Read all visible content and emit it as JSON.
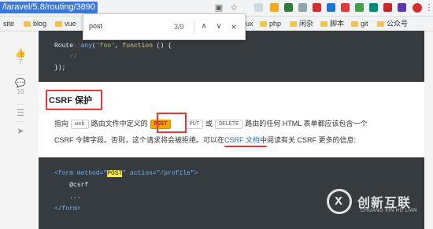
{
  "browser": {
    "url": "/laravel/5.8/routing/3890",
    "bookmarks": [
      {
        "label": "site"
      },
      {
        "label": "blog"
      },
      {
        "label": "vue"
      },
      {
        "label": "ux"
      },
      {
        "label": "php"
      },
      {
        "label": "闲杂"
      },
      {
        "label": "脚本"
      },
      {
        "label": "git"
      },
      {
        "label": "公众号"
      }
    ]
  },
  "find": {
    "query": "post",
    "count": "3/9",
    "prev": "∧",
    "next": "∨",
    "close": "×"
  },
  "sidebar": {
    "likes": "7",
    "comments": "10"
  },
  "code1": {
    "line1_a": "Route",
    "line1_b": "::",
    "line1_c": "any",
    "line1_d": "(",
    "line1_e": "'foo'",
    "line1_f": ", ",
    "line1_g": "function",
    "line1_h": " () {",
    "line2": "    //",
    "line3": "});"
  },
  "section": {
    "heading": "CSRF 保护",
    "p1_a": "指向",
    "p1_tag_web": "web",
    "p1_b": "路由文件中定义的",
    "p1_tag_post": "POST",
    "p1_tag_put": "PUT",
    "p1_c": "或",
    "p1_tag_delete": "DELETE",
    "p1_d": "路由的任何 HTML 表单都应该包含一个",
    "p2_a": "CSRF 令牌字段。否则，这个请求将会被拒绝。可以在",
    "p2_link": "CSRF 文档",
    "p2_b": "中阅读有关 CSRF 更多的信息:"
  },
  "code2": {
    "l1_a": "<form method=\"",
    "l1_hl": "POST",
    "l1_b": "\" action=\"/profile\">",
    "l2": "    @csrf",
    "l3": "    ...",
    "l4": "</form>"
  },
  "watermark": {
    "cn": "创新互联",
    "en": "CHUANG XIN HU LIAN"
  },
  "colors": {
    "accent": "#3b78d8",
    "highlight_box": "#e53935",
    "code_bg": "#363b3f"
  }
}
